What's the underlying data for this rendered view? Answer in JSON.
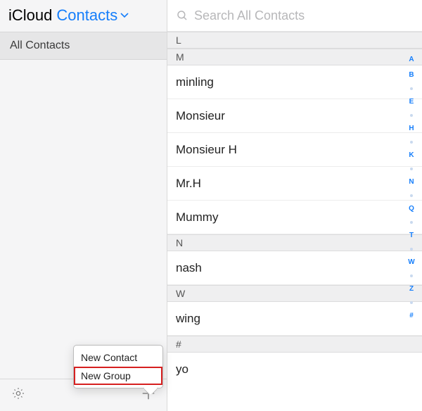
{
  "header": {
    "app_title": "iCloud",
    "dropdown_label": "Contacts"
  },
  "sidebar": {
    "groups": [
      "All Contacts"
    ]
  },
  "popover": {
    "items": [
      "New Contact",
      "New Group"
    ],
    "highlighted_index": 1
  },
  "search": {
    "placeholder": "Search All Contacts"
  },
  "sections": [
    {
      "letter": "L",
      "contacts": []
    },
    {
      "letter": "M",
      "contacts": [
        "minling",
        "Monsieur",
        "Monsieur H",
        "Mr.H",
        "Mummy"
      ]
    },
    {
      "letter": "N",
      "contacts": [
        "nash"
      ]
    },
    {
      "letter": "W",
      "contacts": [
        "wing"
      ]
    },
    {
      "letter": "#",
      "contacts": [
        "yo"
      ]
    }
  ],
  "alpha_index": [
    "A",
    "B",
    "",
    "E",
    "",
    "H",
    "",
    "K",
    "",
    "N",
    "",
    "Q",
    "",
    "T",
    "",
    "W",
    "",
    "Z",
    "",
    "#"
  ]
}
